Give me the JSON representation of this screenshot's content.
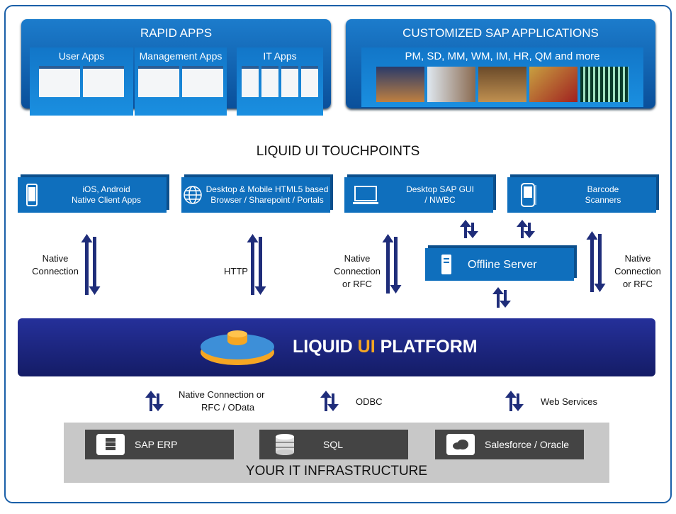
{
  "rapid_apps": {
    "title": "RAPID APPS",
    "groups": [
      "User Apps",
      "Management Apps",
      "IT Apps"
    ]
  },
  "custom_sap": {
    "title": "CUSTOMIZED SAP APPLICATIONS",
    "modules": "PM, SD, MM, WM, IM, HR, QM and more"
  },
  "touchpoints": {
    "title": "LIQUID UI TOUCHPOINTS",
    "items": [
      {
        "line1": "iOS, Android",
        "line2": "Native Client Apps",
        "icon": "smartphone-icon"
      },
      {
        "line1": "Desktop & Mobile HTML5 based",
        "line2": "Browser / Sharepoint / Portals",
        "icon": "globe-icon"
      },
      {
        "line1": "Desktop SAP GUI",
        "line2": "/ NWBC",
        "icon": "monitor-icon"
      },
      {
        "line1": "Barcode",
        "line2": "Scanners",
        "icon": "barcode-scanner-icon"
      }
    ]
  },
  "offline_server": {
    "label": "Offline Server",
    "icon": "server-icon"
  },
  "connections": {
    "native": [
      "Native",
      "Connection"
    ],
    "http": "HTTP",
    "native_rfc_left": [
      "Native",
      "Connection",
      "or RFC"
    ],
    "native_rfc_right": [
      "Native",
      "Connection",
      "or RFC"
    ]
  },
  "platform": {
    "pre": "LIQUID ",
    "highlight": "UI",
    "post": " PLATFORM",
    "highlight_color": "#f5a623"
  },
  "backend_connections": {
    "native": [
      "Native Connection or",
      "RFC / OData"
    ],
    "odbc": "ODBC",
    "web": "Web Services"
  },
  "infrastructure": {
    "title": "YOUR IT INFRASTRUCTURE",
    "items": [
      {
        "label": "SAP ERP",
        "icon": "database-monitor-icon"
      },
      {
        "label": "SQL",
        "icon": "database-icon"
      },
      {
        "label": "Salesforce / Oracle",
        "icon": "cloud-monitor-icon"
      }
    ]
  },
  "colors": {
    "box_blue": "#0f6fbd",
    "arrow_navy": "#1f2d7a",
    "platform_navy": "#1b2480"
  }
}
